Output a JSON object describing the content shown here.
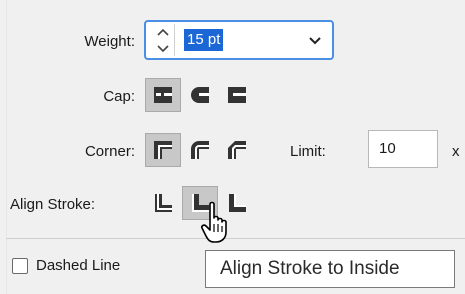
{
  "weight": {
    "label": "Weight:",
    "value": "15 pt",
    "step_up_icon": "chevron-up-icon",
    "step_down_icon": "chevron-down-icon",
    "dropdown_icon": "chevron-down-icon"
  },
  "cap": {
    "label": "Cap:",
    "options": [
      {
        "name": "butt-cap",
        "icon": "butt-cap-icon",
        "selected": true
      },
      {
        "name": "round-cap",
        "icon": "round-cap-icon",
        "selected": false
      },
      {
        "name": "projecting-cap",
        "icon": "projecting-cap-icon",
        "selected": false
      }
    ]
  },
  "corner": {
    "label": "Corner:",
    "options": [
      {
        "name": "miter-join",
        "icon": "miter-join-icon",
        "selected": true
      },
      {
        "name": "round-join",
        "icon": "round-join-icon",
        "selected": false
      },
      {
        "name": "bevel-join",
        "icon": "bevel-join-icon",
        "selected": false
      }
    ],
    "limit_label": "Limit:",
    "limit_value": "10",
    "limit_unit": "x"
  },
  "align_stroke": {
    "label": "Align Stroke:",
    "options": [
      {
        "name": "align-center",
        "icon": "align-stroke-center-icon",
        "selected": false
      },
      {
        "name": "align-inside",
        "icon": "align-stroke-inside-icon",
        "selected": true
      },
      {
        "name": "align-outside",
        "icon": "align-stroke-outside-icon",
        "selected": false
      }
    ]
  },
  "dashed_line": {
    "label": "Dashed Line",
    "checked": false
  },
  "tooltip": {
    "text": "Align Stroke to Inside"
  },
  "colors": {
    "accent": "#4a8ee6",
    "selection": "#1b67d6",
    "panel": "#f0f0f0",
    "icon": "#333333"
  }
}
